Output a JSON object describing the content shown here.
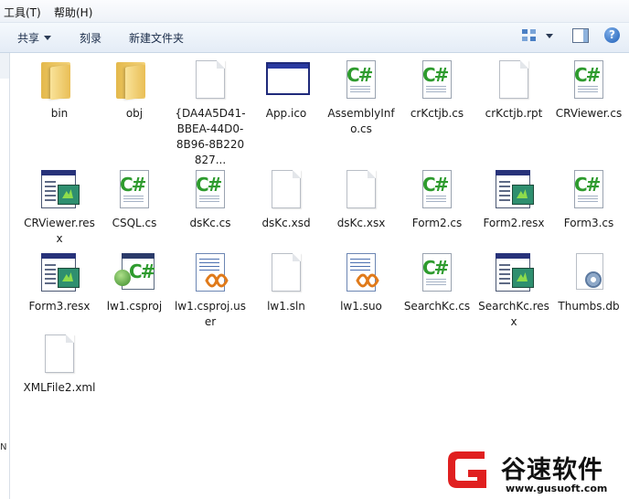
{
  "menu": {
    "tools": "工具(T)",
    "help": "帮助(H)"
  },
  "toolbar": {
    "share": "共享",
    "burn": "刻录",
    "new_folder": "新建文件夹",
    "help_icon": "?"
  },
  "nav_pane": {
    "partial_text": "N"
  },
  "files": [
    {
      "name": "bin",
      "icon": "folder-icon"
    },
    {
      "name": "obj",
      "icon": "folder-icon"
    },
    {
      "name": "{DA4A5D41-BBEA-44D0-8B96-8B220827...",
      "icon": "generic-file-icon"
    },
    {
      "name": "App.ico",
      "icon": "application-window-icon"
    },
    {
      "name": "AssemblyInfo.cs",
      "icon": "csharp-file-icon"
    },
    {
      "name": "crKctjb.cs",
      "icon": "csharp-file-icon"
    },
    {
      "name": "crKctjb.rpt",
      "icon": "generic-file-icon"
    },
    {
      "name": "CRViewer.cs",
      "icon": "csharp-file-icon"
    },
    {
      "name": "CRViewer.resx",
      "icon": "resx-file-icon"
    },
    {
      "name": "CSQL.cs",
      "icon": "csharp-file-icon"
    },
    {
      "name": "dsKc.cs",
      "icon": "csharp-file-icon"
    },
    {
      "name": "dsKc.xsd",
      "icon": "generic-file-icon"
    },
    {
      "name": "dsKc.xsx",
      "icon": "generic-file-icon"
    },
    {
      "name": "Form2.cs",
      "icon": "csharp-file-icon"
    },
    {
      "name": "Form2.resx",
      "icon": "resx-file-icon"
    },
    {
      "name": "Form3.cs",
      "icon": "csharp-file-icon"
    },
    {
      "name": "Form3.resx",
      "icon": "resx-file-icon"
    },
    {
      "name": "lw1.csproj",
      "icon": "csproj-file-icon"
    },
    {
      "name": "lw1.csproj.user",
      "icon": "visual-studio-file-icon"
    },
    {
      "name": "lw1.sln",
      "icon": "generic-file-icon"
    },
    {
      "name": "lw1.suo",
      "icon": "visual-studio-file-icon"
    },
    {
      "name": "SearchKc.cs",
      "icon": "csharp-file-icon"
    },
    {
      "name": "SearchKc.resx",
      "icon": "resx-file-icon"
    },
    {
      "name": "Thumbs.db",
      "icon": "thumbs-db-icon"
    },
    {
      "name": "XMLFile2.xml",
      "icon": "generic-file-icon"
    }
  ],
  "watermark": {
    "brand": "谷速软件",
    "url": "www.gusuoft.com",
    "colors": {
      "red": "#e02020",
      "dark": "#111111"
    }
  },
  "colors": {
    "menubar": "#eef2f8",
    "toolbar": "#e4ecf6",
    "csharp_green": "#2e9b2e",
    "folder_yellow": "#f4d37a"
  }
}
